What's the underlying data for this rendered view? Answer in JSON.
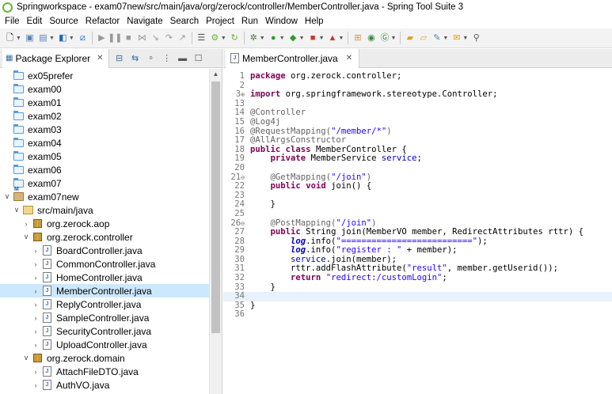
{
  "window": {
    "title": "Springworkspace - exam07new/src/main/java/org/zerock/controller/MemberController.java - Spring Tool Suite 3"
  },
  "menu": [
    "File",
    "Edit",
    "Source",
    "Refactor",
    "Navigate",
    "Search",
    "Project",
    "Run",
    "Window",
    "Help"
  ],
  "package_explorer": {
    "tab_label": "Package Explorer",
    "tree": [
      {
        "depth": 0,
        "twisty": "",
        "icon": "folder-icon",
        "label": "ex05prefer",
        "selected": false
      },
      {
        "depth": 0,
        "twisty": "",
        "icon": "folder-icon",
        "label": "exam00",
        "selected": false
      },
      {
        "depth": 0,
        "twisty": "",
        "icon": "folder-icon",
        "label": "exam01",
        "selected": false
      },
      {
        "depth": 0,
        "twisty": "",
        "icon": "folder-icon",
        "label": "exam02",
        "selected": false
      },
      {
        "depth": 0,
        "twisty": "",
        "icon": "folder-icon",
        "label": "exam03",
        "selected": false
      },
      {
        "depth": 0,
        "twisty": "",
        "icon": "folder-icon",
        "label": "exam04",
        "selected": false
      },
      {
        "depth": 0,
        "twisty": "",
        "icon": "folder-icon",
        "label": "exam05",
        "selected": false
      },
      {
        "depth": 0,
        "twisty": "",
        "icon": "folder-icon",
        "label": "exam06",
        "selected": false
      },
      {
        "depth": 0,
        "twisty": "",
        "icon": "folder-icon",
        "label": "exam07",
        "selected": false
      },
      {
        "depth": 0,
        "twisty": "expanded",
        "icon": "maven-project-icon",
        "label": "exam07new",
        "selected": false
      },
      {
        "depth": 1,
        "twisty": "expanded",
        "icon": "source-folder-icon",
        "label": "src/main/java",
        "selected": false
      },
      {
        "depth": 2,
        "twisty": "collapsed",
        "icon": "package-icon",
        "label": "org.zerock.aop",
        "selected": false
      },
      {
        "depth": 2,
        "twisty": "expanded",
        "icon": "package-icon",
        "label": "org.zerock.controller",
        "selected": false
      },
      {
        "depth": 3,
        "twisty": "collapsed",
        "icon": "java-file-icon",
        "label": "BoardController.java",
        "selected": false
      },
      {
        "depth": 3,
        "twisty": "collapsed",
        "icon": "java-file-icon",
        "label": "CommonController.java",
        "selected": false
      },
      {
        "depth": 3,
        "twisty": "collapsed",
        "icon": "java-file-icon",
        "label": "HomeController.java",
        "selected": false
      },
      {
        "depth": 3,
        "twisty": "collapsed",
        "icon": "java-file-icon",
        "label": "MemberController.java",
        "selected": true
      },
      {
        "depth": 3,
        "twisty": "collapsed",
        "icon": "java-file-icon",
        "label": "ReplyController.java",
        "selected": false
      },
      {
        "depth": 3,
        "twisty": "collapsed",
        "icon": "java-file-icon",
        "label": "SampleController.java",
        "selected": false
      },
      {
        "depth": 3,
        "twisty": "collapsed",
        "icon": "java-file-icon",
        "label": "SecurityController.java",
        "selected": false
      },
      {
        "depth": 3,
        "twisty": "collapsed",
        "icon": "java-file-icon",
        "label": "UploadController.java",
        "selected": false
      },
      {
        "depth": 2,
        "twisty": "expanded",
        "icon": "package-icon",
        "label": "org.zerock.domain",
        "selected": false
      },
      {
        "depth": 3,
        "twisty": "collapsed",
        "icon": "java-file-icon",
        "label": "AttachFileDTO.java",
        "selected": false
      },
      {
        "depth": 3,
        "twisty": "collapsed",
        "icon": "java-file-icon",
        "label": "AuthVO.java",
        "selected": false
      }
    ]
  },
  "editor": {
    "tab_label": "MemberController.java",
    "highlighted_line": "34",
    "lines": [
      {
        "n": "1",
        "fold": "",
        "segs": [
          [
            "kw",
            "package"
          ],
          [
            "",
            "org.zerock.controller;"
          ]
        ]
      },
      {
        "n": "2",
        "fold": "",
        "segs": []
      },
      {
        "n": "3",
        "fold": "⊕",
        "segs": [
          [
            "kw",
            "import"
          ],
          [
            "",
            "org.springframework.stereotype.Controller;"
          ]
        ]
      },
      {
        "n": "13",
        "fold": "",
        "segs": []
      },
      {
        "n": "14",
        "fold": "",
        "segs": [
          [
            "ann",
            "@Controller"
          ]
        ]
      },
      {
        "n": "15",
        "fold": "",
        "segs": [
          [
            "ann",
            "@Log4j"
          ]
        ]
      },
      {
        "n": "16",
        "fold": "",
        "segs": [
          [
            "ann",
            "@RequestMapping("
          ],
          [
            "str",
            "\"/member/*\""
          ],
          [
            "ann",
            ")"
          ]
        ]
      },
      {
        "n": "17",
        "fold": "",
        "segs": [
          [
            "ann",
            "@AllArgsConstructor"
          ]
        ]
      },
      {
        "n": "18",
        "fold": "",
        "segs": [
          [
            "kw",
            "public"
          ],
          [
            "",
            " "
          ],
          [
            "kw",
            "class"
          ],
          [
            "",
            " MemberController {"
          ]
        ]
      },
      {
        "n": "19",
        "fold": "",
        "segs": [
          [
            "",
            "    "
          ],
          [
            "kw",
            "private"
          ],
          [
            "",
            " MemberService "
          ],
          [
            "fld",
            "service"
          ],
          [
            "",
            ";"
          ]
        ]
      },
      {
        "n": "20",
        "fold": "",
        "segs": []
      },
      {
        "n": "21",
        "fold": "⊖",
        "segs": [
          [
            "",
            "    "
          ],
          [
            "ann",
            "@GetMapping("
          ],
          [
            "str",
            "\"/join\""
          ],
          [
            "ann",
            ")"
          ]
        ]
      },
      {
        "n": "22",
        "fold": "",
        "segs": [
          [
            "",
            "    "
          ],
          [
            "kw",
            "public"
          ],
          [
            "",
            " "
          ],
          [
            "kw",
            "void"
          ],
          [
            "",
            " join() {"
          ]
        ]
      },
      {
        "n": "23",
        "fold": "",
        "segs": []
      },
      {
        "n": "24",
        "fold": "",
        "segs": [
          [
            "",
            "    }"
          ]
        ]
      },
      {
        "n": "25",
        "fold": "",
        "segs": []
      },
      {
        "n": "26",
        "fold": "⊖",
        "segs": [
          [
            "",
            "    "
          ],
          [
            "ann",
            "@PostMapping("
          ],
          [
            "str",
            "\"/join\""
          ],
          [
            "ann",
            ")"
          ]
        ]
      },
      {
        "n": "27",
        "fold": "",
        "segs": [
          [
            "",
            "    "
          ],
          [
            "kw",
            "public"
          ],
          [
            "",
            " String join(MemberVO member, RedirectAttributes rttr) {"
          ]
        ]
      },
      {
        "n": "28",
        "fold": "",
        "segs": [
          [
            "",
            "        "
          ],
          [
            "stat",
            "log"
          ],
          [
            "",
            ".info("
          ],
          [
            "str",
            "\"==========================\""
          ],
          [
            "",
            ");"
          ]
        ]
      },
      {
        "n": "29",
        "fold": "",
        "segs": [
          [
            "",
            "        "
          ],
          [
            "stat",
            "log"
          ],
          [
            "",
            ".info("
          ],
          [
            "str",
            "\"register : \""
          ],
          [
            "",
            " + member);"
          ]
        ]
      },
      {
        "n": "30",
        "fold": "",
        "segs": [
          [
            "",
            "        "
          ],
          [
            "fld",
            "service"
          ],
          [
            "",
            ".join(member);"
          ]
        ]
      },
      {
        "n": "31",
        "fold": "",
        "segs": [
          [
            "",
            "        rttr.addFlashAttribute("
          ],
          [
            "str",
            "\"result\""
          ],
          [
            "",
            ", member.getUserid());"
          ]
        ]
      },
      {
        "n": "32",
        "fold": "",
        "segs": [
          [
            "",
            "        "
          ],
          [
            "kw",
            "return"
          ],
          [
            "",
            " "
          ],
          [
            "str",
            "\"redirect:/customLogin\""
          ],
          [
            "",
            ";"
          ]
        ]
      },
      {
        "n": "33",
        "fold": "",
        "segs": [
          [
            "",
            "    }"
          ]
        ]
      },
      {
        "n": "34",
        "fold": "",
        "segs": []
      },
      {
        "n": "35",
        "fold": "",
        "segs": [
          [
            "",
            "}"
          ]
        ]
      },
      {
        "n": "36",
        "fold": "",
        "segs": []
      }
    ]
  }
}
